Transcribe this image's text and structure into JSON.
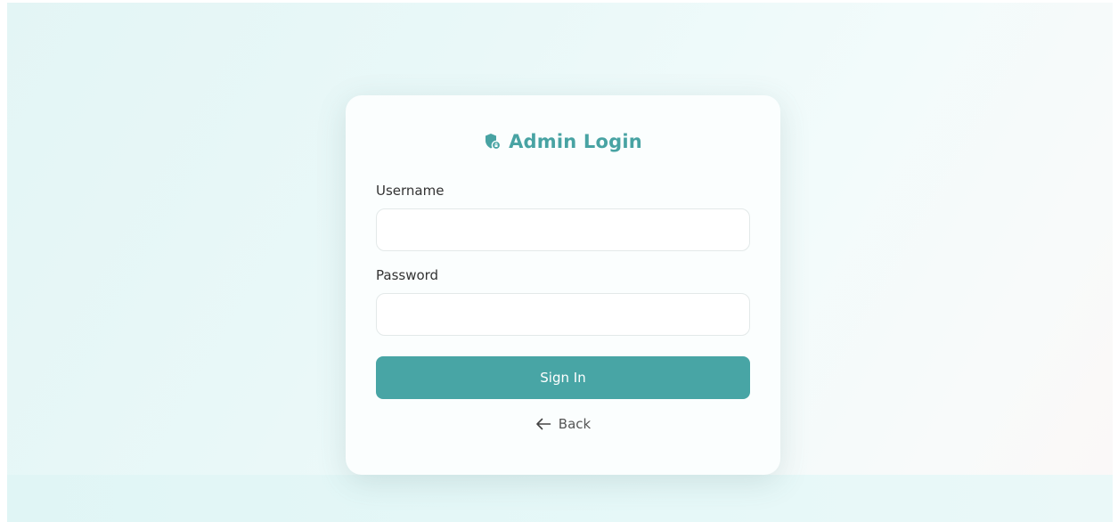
{
  "login": {
    "title": "Admin Login",
    "username_label": "Username",
    "username_value": "",
    "password_label": "Password",
    "password_value": "",
    "signin_label": "Sign In",
    "back_label": "Back"
  },
  "icons": {
    "title_icon": "shield-lock-icon",
    "back_icon": "arrow-left-icon"
  },
  "colors": {
    "accent": "#48a5a5",
    "title": "#48a3a3"
  }
}
